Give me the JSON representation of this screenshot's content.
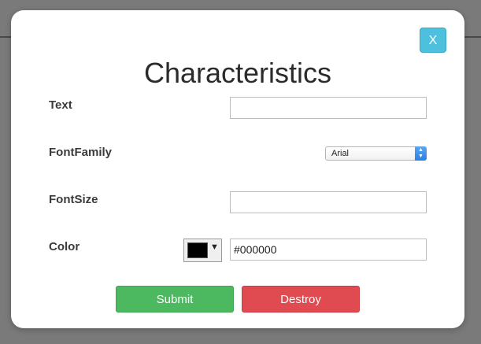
{
  "dialog": {
    "title": "Characteristics",
    "close_label": "X"
  },
  "fields": {
    "text": {
      "label": "Text",
      "value": ""
    },
    "font_family": {
      "label": "FontFamily",
      "selected": "Arial"
    },
    "font_size": {
      "label": "FontSize",
      "value": ""
    },
    "color": {
      "label": "Color",
      "value": "#000000",
      "swatch_color": "#000000"
    }
  },
  "actions": {
    "submit_label": "Submit",
    "destroy_label": "Destroy"
  },
  "colors": {
    "close_button": "#4cc0dd",
    "submit_button": "#4cb85f",
    "destroy_button": "#e04b52"
  }
}
